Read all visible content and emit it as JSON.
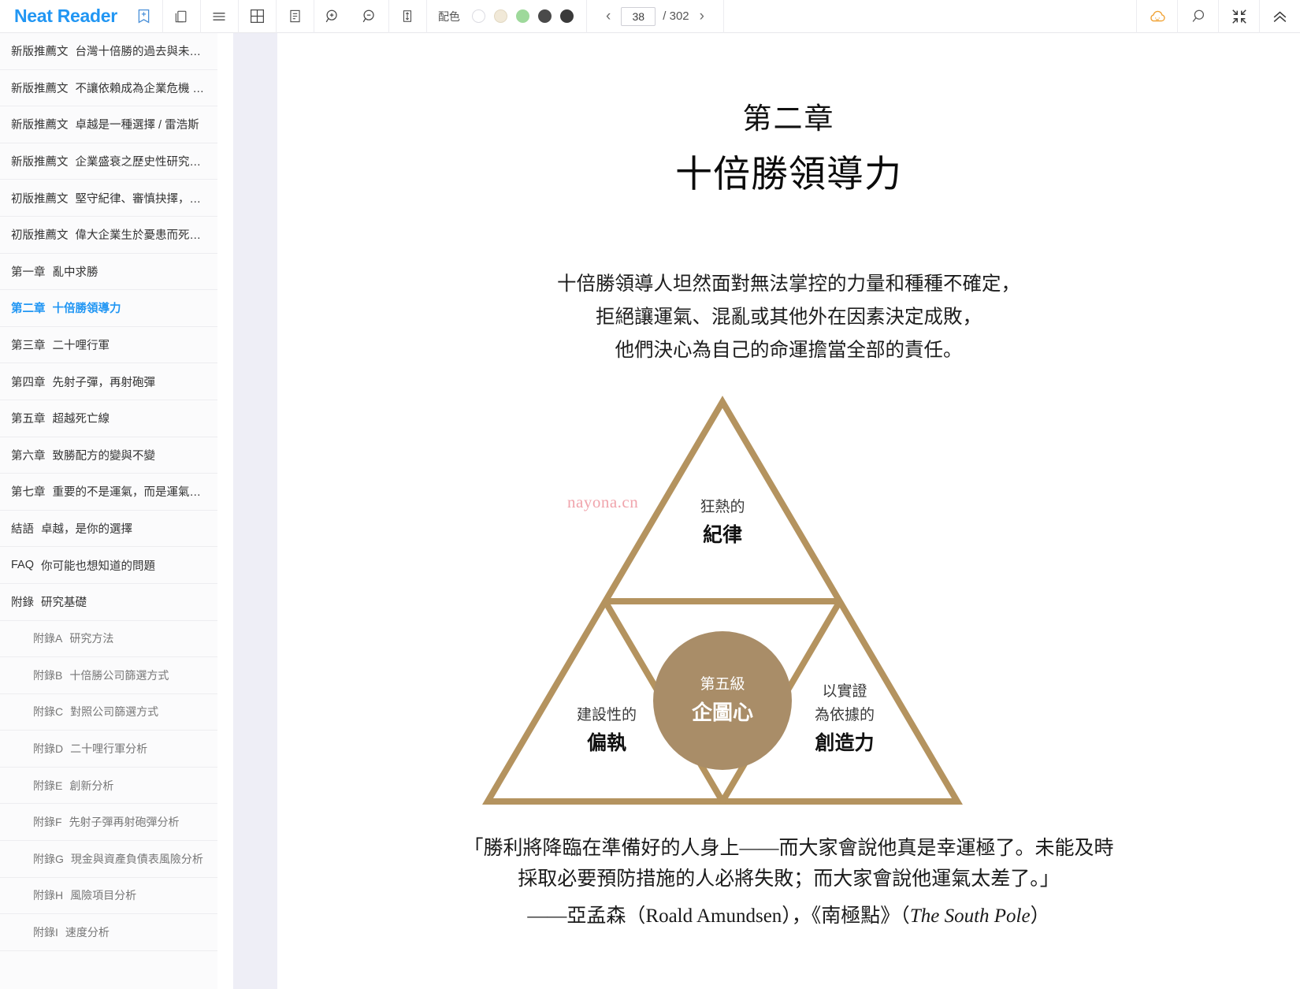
{
  "app": {
    "brand": "Neat Reader"
  },
  "toolbar": {
    "icons": [
      {
        "name": "save-to-library-icon",
        "glyph": "save"
      },
      {
        "name": "library-icon",
        "glyph": "books"
      },
      {
        "name": "table-of-contents-icon",
        "glyph": "menu"
      },
      {
        "name": "grid-view-icon",
        "glyph": "grid"
      },
      {
        "name": "notes-icon",
        "glyph": "note"
      },
      {
        "name": "zoom-in-icon",
        "glyph": "zoom-in"
      },
      {
        "name": "zoom-out-icon",
        "glyph": "zoom-out"
      },
      {
        "name": "line-height-icon",
        "glyph": "line-height"
      }
    ],
    "palette_label": "配色",
    "swatches": [
      {
        "name": "theme-white",
        "color": "#ffffff",
        "border": "#dcdce2",
        "selected": false
      },
      {
        "name": "theme-sepia",
        "color": "#f1e9d8",
        "border": "#e0d6c0",
        "selected": false
      },
      {
        "name": "theme-green",
        "color": "#9ed99b",
        "border": "#9ed99b",
        "selected": false
      },
      {
        "name": "theme-dark-gray",
        "color": "#4a4a4a",
        "border": "#4a4a4a",
        "selected": false
      },
      {
        "name": "theme-black",
        "color": "#3a3a3a",
        "border": "#3a3a3a",
        "selected": false
      }
    ],
    "pager": {
      "prev_label": "‹",
      "next_label": "›",
      "current_page": "38",
      "separator": "/ 302",
      "total_pages": "302"
    },
    "right_icons": [
      {
        "name": "cloud-sync-icon",
        "glyph": "cloud",
        "color": "#f0a030"
      },
      {
        "name": "search-icon",
        "glyph": "search",
        "color": "#5a5a5a"
      },
      {
        "name": "collapse-icon",
        "glyph": "collapse",
        "color": "#3a3a3a"
      },
      {
        "name": "chevrons-up-icon",
        "glyph": "chevrons-up",
        "color": "#3a3a3a"
      }
    ]
  },
  "sidebar": {
    "items": [
      {
        "num": "新版推薦文",
        "title": "台灣十倍勝的過去與未來…",
        "level": 1,
        "active": false
      },
      {
        "num": "新版推薦文",
        "title": "不讓依賴成為企業危機 / …",
        "level": 1,
        "active": false
      },
      {
        "num": "新版推薦文",
        "title": "卓越是一種選擇 / 雷浩斯",
        "level": 1,
        "active": false
      },
      {
        "num": "新版推薦文",
        "title": "企業盛衰之歷史性研究精…",
        "level": 1,
        "active": false
      },
      {
        "num": "初版推薦文",
        "title": "堅守紀律、審慎抉擇，才…",
        "level": 1,
        "active": false
      },
      {
        "num": "初版推薦文",
        "title": "偉大企業生於憂患而死於…",
        "level": 1,
        "active": false
      },
      {
        "num": "第一章",
        "title": "亂中求勝",
        "level": 1,
        "active": false
      },
      {
        "num": "第二章",
        "title": "十倍勝領導力",
        "level": 1,
        "active": true
      },
      {
        "num": "第三章",
        "title": "二十哩行軍",
        "level": 1,
        "active": false
      },
      {
        "num": "第四章",
        "title": "先射子彈，再射砲彈",
        "level": 1,
        "active": false
      },
      {
        "num": "第五章",
        "title": "超越死亡線",
        "level": 1,
        "active": false
      },
      {
        "num": "第六章",
        "title": "致勝配方的變與不變",
        "level": 1,
        "active": false
      },
      {
        "num": "第七章",
        "title": "重要的不是運氣，而是運氣報…",
        "level": 1,
        "active": false
      },
      {
        "num": "結語",
        "title": "卓越，是你的選擇",
        "level": 1,
        "active": false
      },
      {
        "num": "FAQ",
        "title": "你可能也想知道的問題",
        "level": 1,
        "active": false
      },
      {
        "num": "附錄",
        "title": "研究基礎",
        "level": 1,
        "active": false
      },
      {
        "num": "附錄A",
        "title": "研究方法",
        "level": 2,
        "active": false
      },
      {
        "num": "附錄B",
        "title": "十倍勝公司篩選方式",
        "level": 2,
        "active": false
      },
      {
        "num": "附錄C",
        "title": "對照公司篩選方式",
        "level": 2,
        "active": false
      },
      {
        "num": "附錄D",
        "title": "二十哩行軍分析",
        "level": 2,
        "active": false
      },
      {
        "num": "附錄E",
        "title": "創新分析",
        "level": 2,
        "active": false
      },
      {
        "num": "附錄F",
        "title": "先射子彈再射砲彈分析",
        "level": 2,
        "active": false
      },
      {
        "num": "附錄G",
        "title": "現金與資產負債表風險分析",
        "level": 2,
        "active": false
      },
      {
        "num": "附錄H",
        "title": "風險項目分析",
        "level": 2,
        "active": false
      },
      {
        "num": "附錄I",
        "title": "速度分析",
        "level": 2,
        "active": false
      }
    ]
  },
  "page": {
    "chapter_number": "第二章",
    "chapter_title": "十倍勝領導力",
    "lede": [
      "十倍勝領導人坦然面對無法掌控的力量和種種不確定，",
      "拒絕讓運氣、混亂或其他外在因素決定成敗，",
      "他們決心為自己的命運擔當全部的責任。"
    ],
    "watermark": "nayona.cn",
    "diagram": {
      "stroke_color": "#b4935f",
      "circle_color": "#a98d68",
      "top": {
        "small": "狂熱的",
        "big": "紀律"
      },
      "left": {
        "small": "建設性的",
        "big": "偏執"
      },
      "right_line1": "以實證",
      "right_line2": "為依據的",
      "right_big": "創造力",
      "center": {
        "small": "第五級",
        "big": "企圖心"
      }
    },
    "quote": [
      "「勝利將降臨在準備好的人身上——而大家會說他真是幸運極了。未能及時",
      "採取必要預防措施的人必將失敗；而大家會說他運氣太差了。」"
    ],
    "attribution_prefix": "——亞孟森（Roald Amundsen），《南極點》（",
    "attribution_italic": "The South Pole",
    "attribution_suffix": "）"
  }
}
